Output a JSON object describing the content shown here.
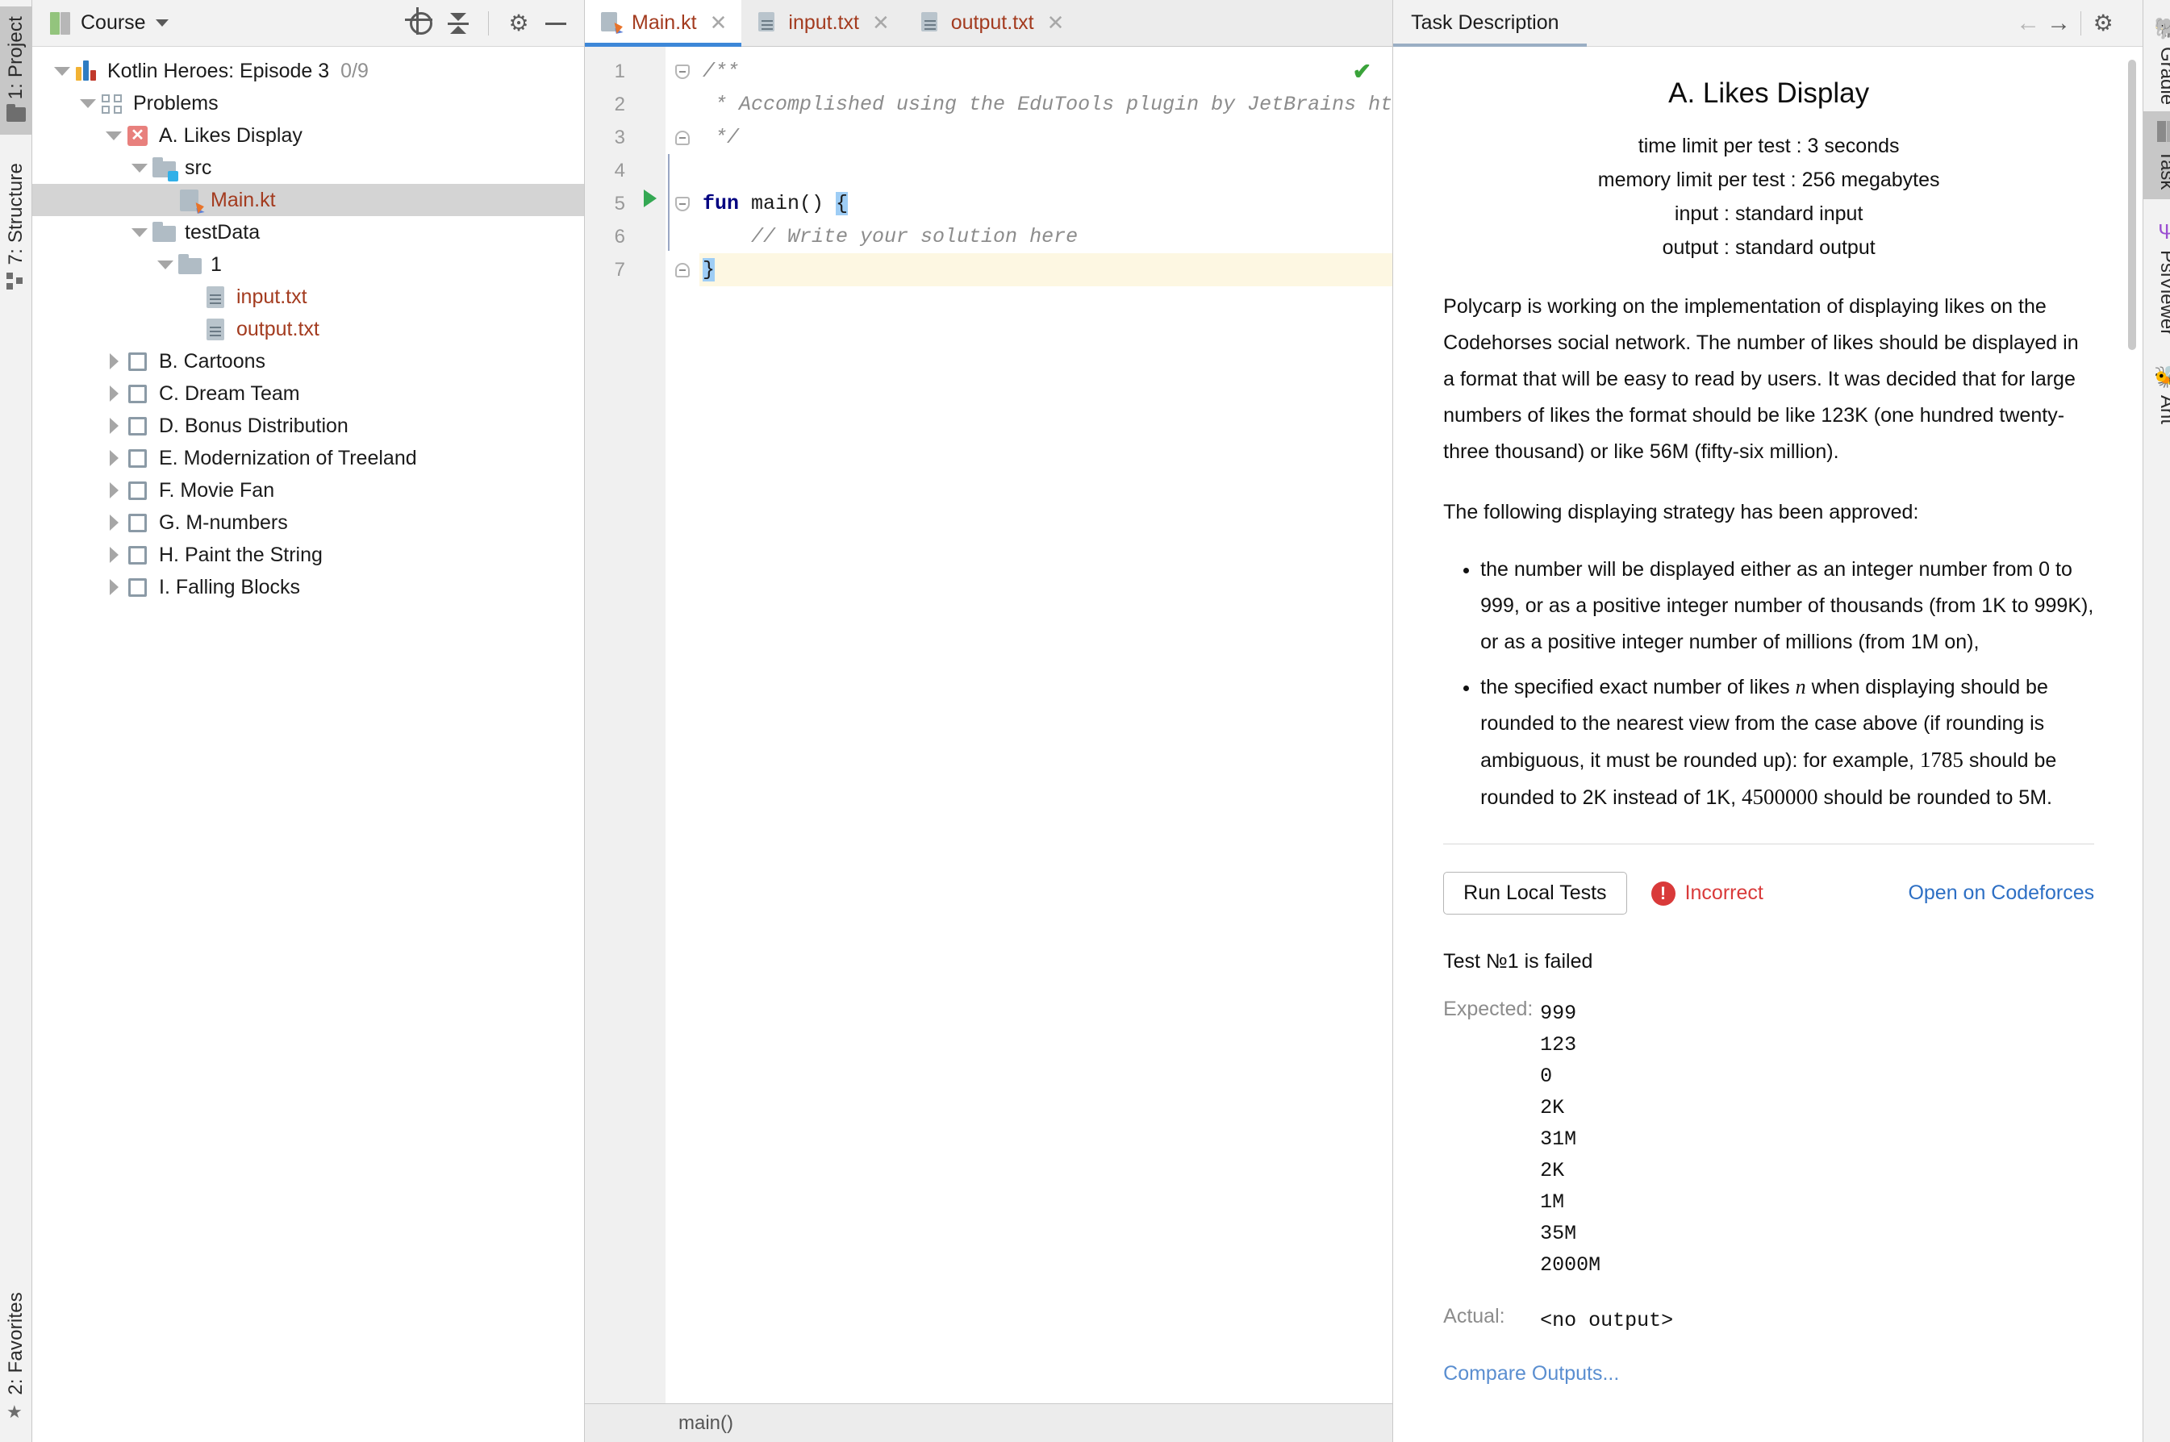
{
  "left_toolbar": [
    {
      "label": "1: Project",
      "icon": "folder-icon",
      "active": true
    },
    {
      "label": "7: Structure",
      "icon": "structure-icon",
      "active": false
    },
    {
      "label": "2: Favorites",
      "icon": "star-icon",
      "active": false
    }
  ],
  "right_toolbar": [
    {
      "label": "Gradle",
      "icon": "elephant-icon",
      "active": false
    },
    {
      "label": "Task",
      "icon": "book-icon",
      "active": true
    },
    {
      "label": "PsiViewer",
      "icon": "trident-icon",
      "active": false
    },
    {
      "label": "Ant",
      "icon": "ant-icon",
      "active": false
    }
  ],
  "project_panel": {
    "title": "Course",
    "icons": {
      "locate": "locate-icon",
      "collapse": "collapse-all-icon",
      "settings": "gear-icon",
      "hide": "minimize-icon"
    },
    "tree": [
      {
        "label": "Kotlin Heroes: Episode 3",
        "suffix": "0/9",
        "indent": 0,
        "twisty": "down",
        "icon": "course-bars-icon"
      },
      {
        "label": "Problems",
        "suffix": "",
        "indent": 1,
        "twisty": "down",
        "icon": "lesson-grid-icon"
      },
      {
        "label": "A. Likes Display",
        "suffix": "",
        "indent": 2,
        "twisty": "down",
        "icon": "task-failed-icon"
      },
      {
        "label": "src",
        "suffix": "",
        "indent": 3,
        "twisty": "down",
        "icon": "source-folder-icon"
      },
      {
        "label": "Main.kt",
        "suffix": "",
        "indent": 4,
        "twisty": "none",
        "icon": "kotlin-file-icon",
        "selected": true,
        "orange": true
      },
      {
        "label": "testData",
        "suffix": "",
        "indent": 3,
        "twisty": "down",
        "icon": "folder-icon"
      },
      {
        "label": "1",
        "suffix": "",
        "indent": 4,
        "twisty": "down",
        "icon": "folder-icon"
      },
      {
        "label": "input.txt",
        "suffix": "",
        "indent": 5,
        "twisty": "none",
        "icon": "text-file-icon",
        "orange": true
      },
      {
        "label": "output.txt",
        "suffix": "",
        "indent": 5,
        "twisty": "none",
        "icon": "text-file-icon",
        "orange": true
      },
      {
        "label": "B. Cartoons",
        "suffix": "",
        "indent": 2,
        "twisty": "right",
        "icon": "task-unchecked-icon"
      },
      {
        "label": "C. Dream Team",
        "suffix": "",
        "indent": 2,
        "twisty": "right",
        "icon": "task-unchecked-icon"
      },
      {
        "label": "D. Bonus Distribution",
        "suffix": "",
        "indent": 2,
        "twisty": "right",
        "icon": "task-unchecked-icon"
      },
      {
        "label": "E. Modernization of Treeland",
        "suffix": "",
        "indent": 2,
        "twisty": "right",
        "icon": "task-unchecked-icon"
      },
      {
        "label": "F. Movie Fan",
        "suffix": "",
        "indent": 2,
        "twisty": "right",
        "icon": "task-unchecked-icon"
      },
      {
        "label": "G. M-numbers",
        "suffix": "",
        "indent": 2,
        "twisty": "right",
        "icon": "task-unchecked-icon"
      },
      {
        "label": "H. Paint the String",
        "suffix": "",
        "indent": 2,
        "twisty": "right",
        "icon": "task-unchecked-icon"
      },
      {
        "label": "I. Falling Blocks",
        "suffix": "",
        "indent": 2,
        "twisty": "right",
        "icon": "task-unchecked-icon"
      }
    ]
  },
  "editor": {
    "tabs": [
      {
        "label": "Main.kt",
        "icon": "kotlin-file-icon",
        "active": true
      },
      {
        "label": "input.txt",
        "icon": "text-file-icon",
        "active": false
      },
      {
        "label": "output.txt",
        "icon": "text-file-icon",
        "active": false
      }
    ],
    "close_glyph": "✕",
    "line_numbers": [
      "1",
      "2",
      "3",
      "4",
      "5",
      "6",
      "7"
    ],
    "code_lines": [
      "/**",
      " * Accomplished using the EduTools plugin by JetBrains ht",
      " */",
      "",
      "fun main() {",
      "    // Write your solution here",
      "}"
    ],
    "inspection_ok_glyph": "✔",
    "status_text": "main()"
  },
  "task_panel": {
    "header_title": "Task Description",
    "nav_back": "←",
    "nav_forward": "→",
    "settings_icon": "gear-icon",
    "hide_icon": "minimize-icon",
    "title": "A. Likes Display",
    "limits": [
      "time limit per test : 3 seconds",
      "memory limit per test : 256 megabytes",
      "input : standard input",
      "output : standard output"
    ],
    "paragraph1": "Polycarp is working on the implementation of displaying likes on the Codehorses social network. The number of likes should be displayed in a format that will be easy to read by users. It was decided that for large numbers of likes the format should be like 123K (one hundred twenty-three thousand) or like 56M (fifty-six million).",
    "paragraph2": "The following displaying strategy has been approved:",
    "bullet1": "the number will be displayed either as an integer number from 0 to 999, or as a positive integer number of thousands (from 1K to 999K), or as a positive integer number of millions (from 1M on),",
    "bullet2_a": "the specified exact number of likes",
    "bullet2_var": "n",
    "bullet2_b": "when displaying should be rounded to the nearest view from the case above (if rounding is ambiguous, it must be rounded up): for example,",
    "bullet2_num1": "1785",
    "bullet2_c": "should be rounded to 2K instead of 1K,",
    "bullet2_num2": "4500000",
    "bullet2_d": "should be rounded to 5M.",
    "run_button": "Run Local Tests",
    "status_label": "Incorrect",
    "status_icon": "error-icon",
    "status_color": "#d93a3a",
    "codeforces_link": "Open on Codeforces",
    "test_result_title": "Test №1 is failed",
    "expected_label": "Expected:",
    "expected_value": "999\n123\n0\n2K\n31M\n2K\n1M\n35M\n2000M",
    "actual_label": "Actual:",
    "actual_value": "<no output>",
    "compare_link": "Compare Outputs..."
  }
}
